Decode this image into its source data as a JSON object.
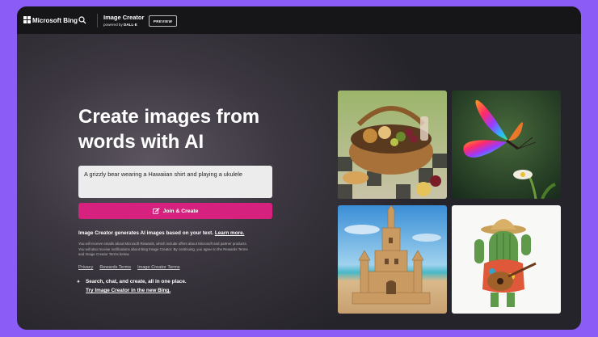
{
  "topbar": {
    "brand": "Microsoft Bing",
    "product_title": "Image Creator",
    "powered_prefix": "powered by",
    "powered_by": "DALL·E",
    "preview_badge": "PREVIEW"
  },
  "hero": {
    "headline": "Create images from words with AI"
  },
  "prompt": {
    "value": "A grizzly bear wearing a Hawaiian shirt and playing a ukulele"
  },
  "create_button": {
    "label": "Join & Create"
  },
  "info": {
    "generates_text": "Image Creator generates AI images based on your text.",
    "learn_more": "Learn more.",
    "fine_print": "You will receive emails about Microsoft Rewards, which include offers about Microsoft and partner products. You will also receive notifications about Bing Image Creator. By continuing, you agree to the Rewards Terms and Image Creator Terms below."
  },
  "links": {
    "privacy": "Privacy",
    "rewards_terms": "Rewards Terms",
    "image_creator_terms": "Image Creator Terms"
  },
  "promo": {
    "line1": "Search, chat, and create, all in one place.",
    "line2": "Try Image Creator in the new Bing."
  },
  "gallery": {
    "images": [
      "picnic-basket-image",
      "rainbow-butterfly-image",
      "sandcastle-image",
      "cactus-guitar-image"
    ]
  },
  "colors": {
    "background": "#8b5cf6",
    "accent": "#d6227e",
    "topbar": "#161618"
  }
}
